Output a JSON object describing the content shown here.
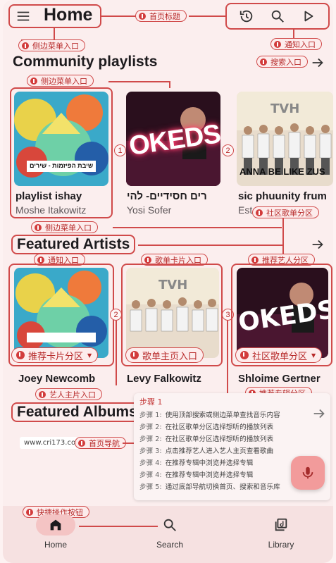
{
  "header": {
    "title": "Home",
    "annotation_title": "首页标题",
    "annotation_notify": "通知入口",
    "annotation_menu": "侧边菜单入口"
  },
  "community": {
    "title": "Community playlists",
    "annotation_search": "搜索入口",
    "annotation_menu": "侧边菜单入口",
    "annotation_community": "社区歌单分区",
    "cards": [
      {
        "title": "playlist   ishay",
        "sub": "Moshe Itakowitz",
        "art_text": "שיבת הפיזמות - שירים"
      },
      {
        "title": "רים חסידיים- להי",
        "sub": "Yosi Sofer",
        "art_text": "OKEDS"
      },
      {
        "title": "sic phuunity  frum",
        "sub": "Est",
        "art_text": "ANNA BE LIKE ZUS"
      }
    ]
  },
  "artists": {
    "title": "Featured Artists",
    "annotation_menu": "侧边菜单入口",
    "annotation_notify": "通知入口",
    "annotation_playlist_card": "歌单卡片入口",
    "annotation_recommend": "推荐艺人分区",
    "annotation_artist_home": "艺人主片入口",
    "chip_recommend": "推荐卡片分区",
    "chip_playlist_home": "歌单主页入口",
    "chip_community": "社区歌单分区",
    "items": [
      {
        "name": "Joey Newcomb"
      },
      {
        "name": "Levy Falkowitz"
      },
      {
        "name": "Shloime Gertner"
      }
    ]
  },
  "albums": {
    "title": "Featured Albums",
    "annotation_recommend_album": "推荐专辑分区",
    "annotation_home_nav": "首页导航",
    "annotation_fab": "快捷操作按钮",
    "url": "www.cri173.com"
  },
  "steps": {
    "title": "步骤 1",
    "rows": [
      {
        "k": "步骤 1:",
        "v": "使用顶部搜索或侧边菜单查找音乐内容"
      },
      {
        "k": "步骤 2:",
        "v": "在社区歌单分区选择想听的播放列表"
      },
      {
        "k": "步骤 2:",
        "v": "在社区歌单分区选择想听的播放列表"
      },
      {
        "k": "步骤 3:",
        "v": "点击推荐艺人进入艺人主页查看歌曲"
      },
      {
        "k": "步骤 4:",
        "v": "在推荐专辑中浏览并选择专辑"
      },
      {
        "k": "步骤 4:",
        "v": "在推荐专辑中浏览并选择专辑"
      },
      {
        "k": "步骤 5:",
        "v": "通过底部导航切换首页、搜索和音乐库"
      }
    ]
  },
  "nav": {
    "home": "Home",
    "search": "Search",
    "library": "Library"
  },
  "colors": {
    "accent": "#d04a4a",
    "background": "#fbeeee",
    "fab": "#f29b9b"
  }
}
